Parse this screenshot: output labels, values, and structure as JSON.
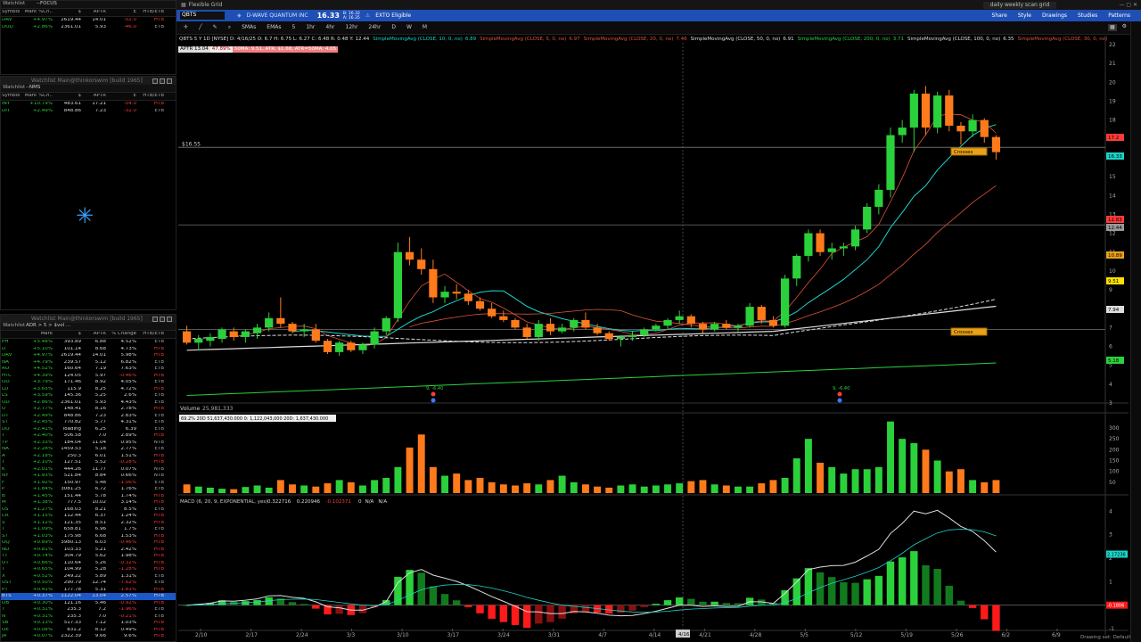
{
  "watchlist1": {
    "title": "Watchlist",
    "list": "--FOCUS",
    "cols": [
      "Symbol",
      "Mark %Ch..",
      "$",
      "APTR",
      "E",
      "HTB/ETB"
    ],
    "rows": [
      [
        "DRV",
        "+4.97%",
        "2619.44",
        "14.01",
        "-52.0",
        "HTB"
      ],
      [
        "DOD",
        "+2.86%",
        "2361.01",
        "5.93",
        "-46.0",
        "ETB"
      ]
    ]
  },
  "watchlist2": {
    "window_title": "Watchlist Main@thinkorswim [build 1965]",
    "title": "Watchlist",
    "list": "--NMS",
    "cols": [
      "Symbol",
      "Mark %Ch..",
      "$",
      "APTR",
      "E",
      "HTB/ETB"
    ],
    "rows": [
      [
        "INY",
        "+10.79%",
        "483.61",
        "17.21",
        "-54.0",
        "HTB"
      ],
      [
        "DIT",
        "+2.49%",
        "848.86",
        "7.23",
        "-32.0",
        "ETB"
      ]
    ]
  },
  "watchlist3": {
    "window_title": "Watchlist Main@thinkorswim [build 1965]",
    "title": "Watchlist",
    "list": "ADR > 5 > $vol ...",
    "cols": [
      "",
      "Mark",
      "$",
      "APTR",
      "% Change",
      "HTB/ETB"
    ],
    "rows": [
      [
        "PH",
        "+5.48%",
        "393.89",
        "6.88",
        "4.52%",
        "ETB"
      ],
      [
        "D",
        "+5.10%",
        "101.14",
        "8.68",
        "4.73%",
        "HTB"
      ],
      [
        "DRV",
        "+4.97%",
        "2619.44",
        "14.01",
        "5.98%",
        "HTB"
      ],
      [
        "NA",
        "+4.79%",
        "239.57",
        "5.12",
        "6.82%",
        "ETB"
      ],
      [
        "RO",
        "+4.52%",
        "160.64",
        "7.19",
        "7.63%",
        "ETB"
      ],
      [
        "HTC",
        "+4.39%",
        "124.05",
        "5.97",
        "-0.46%",
        "HTB"
      ],
      [
        "OD",
        "+3.79%",
        "171.46",
        "8.92",
        "4.05%",
        "ETB"
      ],
      [
        "LD",
        "+3.65%",
        "115.9",
        "8.25",
        "4.72%",
        "HTB"
      ],
      [
        "LS",
        "+3.59%",
        "145.36",
        "5.25",
        "2.6%",
        "ETB"
      ],
      [
        "OD",
        "+2.86%",
        "2361.01",
        "5.93",
        "4.43%",
        "ETB"
      ],
      [
        "U",
        "+2.77%",
        "148.41",
        "8.16",
        "2.78%",
        "HTB"
      ],
      [
        "DT",
        "+2.49%",
        "848.86",
        "7.23",
        "2.83%",
        "ETB"
      ],
      [
        "ST",
        "+2.45%",
        "770.82",
        "5.77",
        "4.31%",
        "ETB"
      ],
      [
        "DO",
        "+2.41%",
        "loading",
        "6.25",
        "6.39",
        "ETB"
      ],
      [
        "T",
        "+2.40%",
        "506.58",
        "7.0",
        "2.89%",
        "HTB"
      ],
      [
        "TP",
        "+2.33%",
        "184.04",
        "11.04",
        "0.95%",
        "NTB"
      ],
      [
        "NA",
        "+2.28%",
        "1459.53",
        "5.18",
        "2.77%",
        "ETB"
      ],
      [
        "A",
        "+2.18%",
        "250.3",
        "6.01",
        "1.51%",
        "HTB"
      ],
      [
        "T",
        "+2.10%",
        "127.51",
        "5.52",
        "-0.28%",
        "HTB"
      ],
      [
        "K",
        "+2.01%",
        "444.26",
        "11.77",
        "0.07%",
        "NTB"
      ],
      [
        "NY",
        "+1.93%",
        "521.84",
        "8.84",
        "0.66%",
        "NTB"
      ],
      [
        "F",
        "+1.92%",
        "150.97",
        "5.48",
        "-1.06%",
        "ETB"
      ],
      [
        "P",
        "+1.84%",
        "3081.25",
        "6.72",
        "1.76%",
        "ETB"
      ],
      [
        "B",
        "+1.45%",
        "151.44",
        "5.78",
        "1.74%",
        "HTB"
      ],
      [
        "M",
        "+1.38%",
        "777.5",
        "10.02",
        "3.14%",
        "HTB"
      ],
      [
        "US",
        "+1.27%",
        "168.03",
        "8.21",
        "8.5%",
        "ETB"
      ],
      [
        "CR",
        "+1.15%",
        "112.44",
        "6.37",
        "1.24%",
        "HTB"
      ],
      [
        "S",
        "+1.12%",
        "121.35",
        "8.51",
        "2.32%",
        "HTB"
      ],
      [
        "T",
        "+1.09%",
        "658.81",
        "6.96",
        "1.7%",
        "ETB"
      ],
      [
        "ST",
        "+1.03%",
        "175.98",
        "6.68",
        "1.53%",
        "HTB"
      ],
      [
        "OQ",
        "+0.89%",
        "3980.13",
        "6.03",
        "-0.46%",
        "HTB"
      ],
      [
        "ND",
        "+0.81%",
        "103.33",
        "5.21",
        "2.42%",
        "HTB"
      ],
      [
        "TT",
        "+0.74%",
        "304.79",
        "5.62",
        "1.98%",
        "HTB"
      ],
      [
        "OT",
        "+0.66%",
        "110.64",
        "5.26",
        "-0.32%",
        "HTB"
      ],
      [
        "T",
        "+0.65%",
        "104.99",
        "5.28",
        "-1.28%",
        "HTB"
      ],
      [
        "X",
        "+0.52%",
        "249.22",
        "5.89",
        "1.31%",
        "ETB"
      ],
      [
        "UST",
        "+0.50%",
        "290.79",
        "12.74",
        "-7.62%",
        "ETB"
      ],
      [
        "PT",
        "+0.41%",
        "177.78",
        "5.31",
        "-1.83%",
        "HTB"
      ],
      [
        "BTS",
        "+0.37%",
        "1122.04",
        "13.04",
        "2.57%",
        "HTB"
      ],
      [
        "OB",
        "+0.30%",
        "121.16",
        "5.46",
        "-0.92%",
        "HTB"
      ],
      [
        "T",
        "+0.31%",
        "235.3",
        "7.2",
        "-1.96%",
        "ETB"
      ],
      [
        "N",
        "+0.31%",
        "235.3",
        "7.0",
        "-0.21%",
        "ETB"
      ],
      [
        "SB",
        "+0.13%",
        "517.33",
        "7.12",
        "1.03%",
        "HTB"
      ],
      [
        "OE",
        "+0.08%",
        "831.2",
        "8.12",
        "0.49%",
        "HTB"
      ],
      [
        "JR",
        "+0.07%",
        "2322.39",
        "9.66",
        "9.6%",
        "HTB"
      ],
      [
        "JA",
        "0.00%",
        "161.84",
        "5.17",
        "-4.32%",
        "HTB"
      ]
    ],
    "selected_index": 38
  },
  "chart_window": {
    "title": "Flexible Grid",
    "right_title": "daily weekly scan grid",
    "symbol": "QBTS",
    "company": "D-WAVE QUANTUM INC",
    "price": "16.33",
    "bid": "B: 16.32",
    "ask": "A: 16.35",
    "exto": "EXTO Eligible",
    "top_right": [
      "Share",
      "Style",
      "Drawings",
      "Studies",
      "Patterns"
    ],
    "periods": [
      "SMAs",
      "EMAs",
      "5",
      "1hr",
      "4hr",
      "12hr",
      "24hr",
      "D",
      "W",
      "M"
    ],
    "ohlc": "QBTS 5 Y 1D [NYSE]   D: 4/16/25   O: 6.7   H: 6.75   L: 6.27   C: 6.48   R: 0.48   Y: 12.44",
    "studies": [
      [
        "SimpleMovingAvg (CLOSE, 10, 0, no)",
        "6.89",
        "#1ad5c9"
      ],
      [
        "SimpleMovingAvg (CLOSE, 5, 0, no)",
        "6.97",
        "#e0533a"
      ],
      [
        "SimpleMovingAvg (CLOSE, 20, 0, no)",
        "7.46",
        "#e0533a"
      ],
      [
        "SimpleMovingAvg (CLOSE, 50, 0, no)",
        "6.91",
        "#ddd"
      ],
      [
        "SimpleMovingAvg (CLOSE, 200, 0, no)",
        "3.71",
        "#2bd13b"
      ],
      [
        "SimpleMovingAvg (CLOSE, 100, 0, no)",
        "6.35",
        "#ddd"
      ],
      [
        "SimpleMovingAvg (CLOSE, 30, 0, no)",
        "",
        "#e0533a"
      ]
    ],
    "aptr": [
      "APTR 13.04",
      "47.89%",
      "50MA: 9.51, ATR: $1.68, ATR=50MA: 4.05"
    ],
    "hline_label": "$16.55",
    "cross1": "Crosses",
    "cross2": "Crosses",
    "price_axis": [
      "22",
      "21",
      "20",
      "19",
      "18",
      "17",
      "16",
      "15",
      "14",
      "13",
      "12",
      "11",
      "10",
      "9",
      "8",
      "7",
      "6",
      "5",
      "4",
      "3"
    ],
    "price_tags": [
      [
        "17.2",
        "#ff3b3b",
        154
      ],
      [
        "16.33",
        "#1ad5c9",
        175
      ],
      [
        "12.83",
        "#ff3b3b",
        246
      ],
      [
        "12.44",
        "#999",
        255
      ],
      [
        "10.89",
        "#e8a217",
        286
      ],
      [
        "9.51",
        "#ffe000",
        315
      ],
      [
        "7.94",
        "#ddd",
        347
      ],
      [
        "5.18",
        "#2bd13b",
        404
      ]
    ],
    "volume_label": "Volume",
    "volume_val": "25,981,333",
    "volume_legend": "69.2%   20D 51,637,430.000   0: 1,122,043,000   20D: 1,637,430.000",
    "vol_axis": [
      "300",
      "250",
      "200",
      "150",
      "100",
      "50"
    ],
    "vol_unit": "millions",
    "macd_label": "MACD (6, 20, 9, EXPONENTIAL, yes)",
    "macd_vals": [
      "0.322716",
      "0.220946",
      "-0.102371",
      "0",
      "N/A",
      "N/A"
    ],
    "macd_axis": [
      "4",
      "3",
      "2",
      "1",
      "0",
      "-1"
    ],
    "macd_tag1": "2.17236",
    "macd_tag2": "-0.1806",
    "dates": [
      "2/10",
      "2/17",
      "2/24",
      "3/3",
      "3/10",
      "3/17",
      "3/24",
      "3/31",
      "4/7",
      "4/14",
      "4/21",
      "4/28",
      "5/5",
      "5/12",
      "5/19",
      "5/26",
      "6/2",
      "6/9"
    ],
    "date_hl": "4/16",
    "earnings_markers": [
      "9, -6.40",
      "9, -6.40"
    ],
    "drawing_set": "Drawing set: Default"
  },
  "colors": {
    "up": "#2bd13b",
    "down": "#ff7a1a",
    "ma10": "#1ad5c9",
    "ma20": "#e0533a",
    "ma50": "#dddddd",
    "ma200": "#2bd13b"
  },
  "chart_data": {
    "type": "candlestick",
    "dates": [
      "2/10",
      "2/17",
      "2/24",
      "3/3",
      "3/10",
      "3/17",
      "3/24",
      "3/31",
      "4/7",
      "4/14",
      "4/21",
      "4/28",
      "5/5",
      "5/12",
      "5/19",
      "5/26",
      "6/2"
    ],
    "ylim": [
      3,
      22
    ],
    "ohlc": [
      [
        6.8,
        7.1,
        6.1,
        6.2
      ],
      [
        6.2,
        6.6,
        5.8,
        6.4
      ],
      [
        6.3,
        6.7,
        6.0,
        6.5
      ],
      [
        6.4,
        7.0,
        6.2,
        6.9
      ],
      [
        6.8,
        7.0,
        6.3,
        6.5
      ],
      [
        6.5,
        6.9,
        6.2,
        6.8
      ],
      [
        6.7,
        7.2,
        6.4,
        7.0
      ],
      [
        7.0,
        7.8,
        6.8,
        7.5
      ],
      [
        7.5,
        8.6,
        7.0,
        7.2
      ],
      [
        7.2,
        7.3,
        6.7,
        6.8
      ],
      [
        6.8,
        7.2,
        6.5,
        6.9
      ],
      [
        6.9,
        7.2,
        6.2,
        6.3
      ],
      [
        6.3,
        6.4,
        5.6,
        5.7
      ],
      [
        5.7,
        6.3,
        5.5,
        6.2
      ],
      [
        6.2,
        6.3,
        5.7,
        5.8
      ],
      [
        5.8,
        6.2,
        5.6,
        6.1
      ],
      [
        6.1,
        7.0,
        5.9,
        6.8
      ],
      [
        6.8,
        7.6,
        6.6,
        7.5
      ],
      [
        7.5,
        11.5,
        7.3,
        11.0
      ],
      [
        11.0,
        11.8,
        10.3,
        10.6
      ],
      [
        10.6,
        11.2,
        9.8,
        10.1
      ],
      [
        10.1,
        10.6,
        8.3,
        8.6
      ],
      [
        8.6,
        9.2,
        8.3,
        8.9
      ],
      [
        8.9,
        9.3,
        8.5,
        8.8
      ],
      [
        8.8,
        9.0,
        8.2,
        8.4
      ],
      [
        8.4,
        8.6,
        7.9,
        8.0
      ],
      [
        8.0,
        8.3,
        7.5,
        7.6
      ],
      [
        7.6,
        7.9,
        7.3,
        7.4
      ],
      [
        7.4,
        7.5,
        6.9,
        7.0
      ],
      [
        7.0,
        7.2,
        6.4,
        6.5
      ],
      [
        6.5,
        7.4,
        6.3,
        7.2
      ],
      [
        7.2,
        7.5,
        6.6,
        6.8
      ],
      [
        6.8,
        7.2,
        6.7,
        7.0
      ],
      [
        7.0,
        7.5,
        6.8,
        7.4
      ],
      [
        7.4,
        7.8,
        6.9,
        7.0
      ],
      [
        7.0,
        7.2,
        6.6,
        6.7
      ],
      [
        6.7,
        6.8,
        6.3,
        6.4
      ],
      [
        6.4,
        6.6,
        6.0,
        6.5
      ],
      [
        6.5,
        6.8,
        6.3,
        6.6
      ],
      [
        6.6,
        7.0,
        6.5,
        6.9
      ],
      [
        6.9,
        7.2,
        6.8,
        7.1
      ],
      [
        7.1,
        7.5,
        6.9,
        7.4
      ],
      [
        7.4,
        7.9,
        7.2,
        7.6
      ],
      [
        7.6,
        7.7,
        7.0,
        7.2
      ],
      [
        7.2,
        7.3,
        6.7,
        6.9
      ],
      [
        6.9,
        7.3,
        6.8,
        7.2
      ],
      [
        7.2,
        7.4,
        6.9,
        7.0
      ],
      [
        7.0,
        7.2,
        6.8,
        7.1
      ],
      [
        7.1,
        8.3,
        7.0,
        8.1
      ],
      [
        8.1,
        8.2,
        7.2,
        7.4
      ],
      [
        7.4,
        7.6,
        7.0,
        7.1
      ],
      [
        7.1,
        9.8,
        7.0,
        9.6
      ],
      [
        9.6,
        10.9,
        9.2,
        10.8
      ],
      [
        10.8,
        12.2,
        10.5,
        12.0
      ],
      [
        12.0,
        12.2,
        10.8,
        11.0
      ],
      [
        11.0,
        11.5,
        10.6,
        11.2
      ],
      [
        11.2,
        11.5,
        10.8,
        11.3
      ],
      [
        11.3,
        12.4,
        11.1,
        12.2
      ],
      [
        12.2,
        13.6,
        12.0,
        13.4
      ],
      [
        13.4,
        14.6,
        13.0,
        14.3
      ],
      [
        14.3,
        17.6,
        13.9,
        17.2
      ],
      [
        17.2,
        18.0,
        16.8,
        17.6
      ],
      [
        17.6,
        19.6,
        16.3,
        19.4
      ],
      [
        19.4,
        19.8,
        17.2,
        17.6
      ],
      [
        17.6,
        19.5,
        17.3,
        19.3
      ],
      [
        19.3,
        19.6,
        17.4,
        17.7
      ],
      [
        17.7,
        17.9,
        16.7,
        17.4
      ],
      [
        17.4,
        18.3,
        17.1,
        18.0
      ],
      [
        18.0,
        18.1,
        16.8,
        17.1
      ],
      [
        17.1,
        17.2,
        15.9,
        16.3
      ]
    ],
    "volume": [
      40,
      30,
      25,
      20,
      18,
      28,
      35,
      25,
      60,
      40,
      35,
      30,
      45,
      60,
      50,
      35,
      60,
      70,
      120,
      210,
      270,
      120,
      80,
      90,
      60,
      70,
      50,
      40,
      35,
      45,
      40,
      60,
      80,
      50,
      40,
      30,
      25,
      35,
      40,
      30,
      35,
      40,
      45,
      55,
      60,
      40,
      35,
      30,
      30,
      45,
      60,
      70,
      160,
      250,
      140,
      120,
      90,
      110,
      110,
      120,
      330,
      250,
      230,
      200,
      150,
      100,
      110,
      60,
      50,
      60
    ],
    "volume_axis": [
      0,
      300
    ],
    "macd_ylim": [
      -1,
      4.2
    ]
  }
}
